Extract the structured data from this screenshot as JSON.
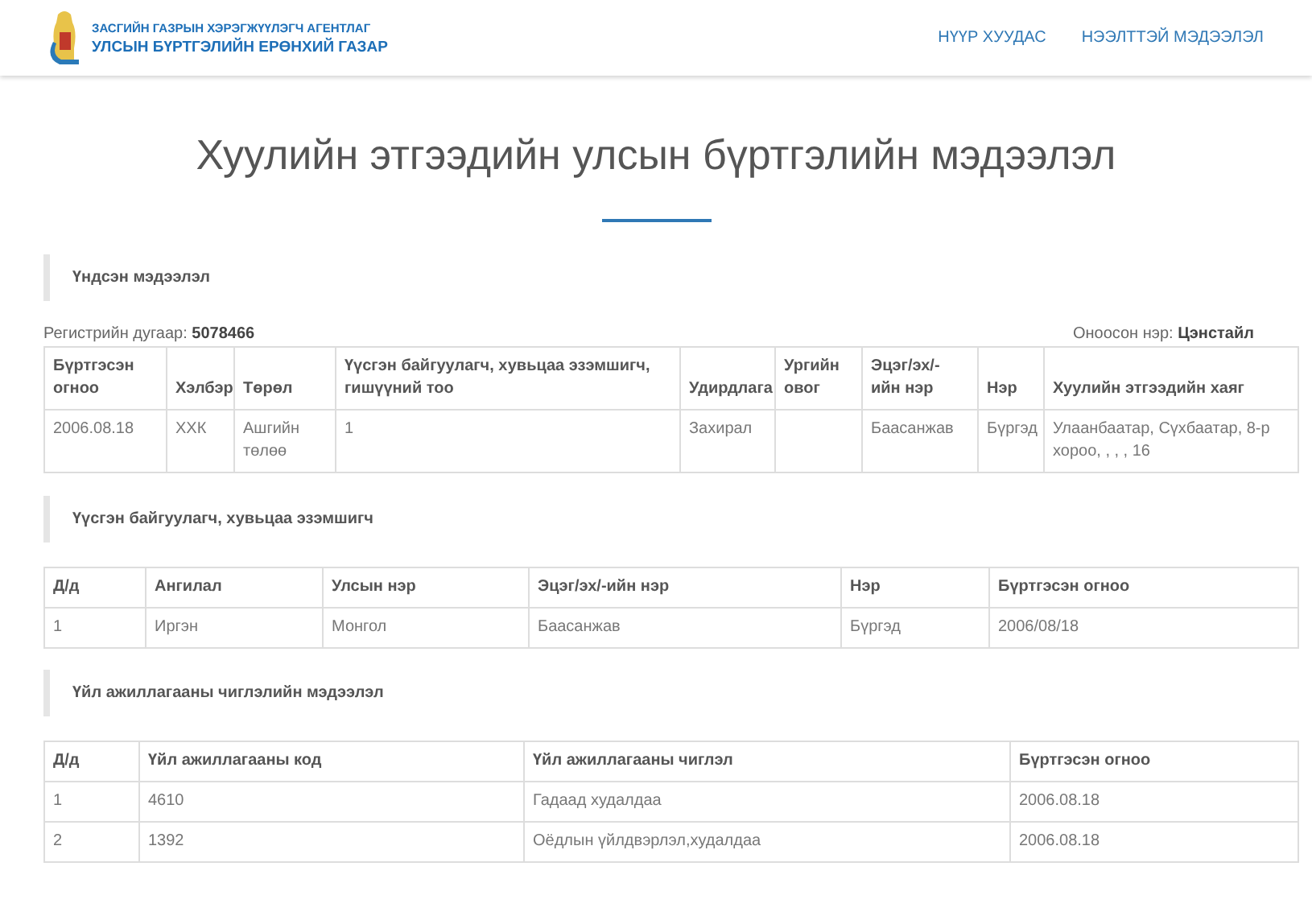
{
  "header": {
    "agency_line1": "ЗАСГИЙН ГАЗРЫН ХЭРЭГЖҮҮЛЭГЧ АГЕНТЛАГ",
    "agency_line2": "УЛСЫН БҮРТГЭЛИЙН ЕРӨНХИЙ ГАЗАР",
    "nav": [
      {
        "label": "НҮҮР ХУУДАС"
      },
      {
        "label": "НЭЭЛТТЭЙ МЭДЭЭЛЭЛ"
      }
    ]
  },
  "title": "Хуулийн этгээдийн улсын бүртгэлийн мэдээлэл",
  "sections": [
    {
      "heading": "Үндсэн мэдээлэл",
      "registration_label": "Регистрийн дугаар:",
      "registration_number": "5078466",
      "name_label": "Оноосон нэр:",
      "name_value": "Цэнстайл",
      "columns": [
        "Бүртгэсэн огноо",
        "Хэлбэр",
        "Төрөл",
        "Үүсгэн байгуулагч, хувьцаа эзэмшигч, гишүүний тоо",
        "Удирдлага",
        "Ургийн овог",
        "Эцэг/эх/-ийн нэр",
        "Нэр",
        "Хуулийн этгээдийн хаяг"
      ],
      "rows": [
        [
          "2006.08.18",
          "ХХК",
          "Ашгийн төлөө",
          "1",
          "Захирал",
          "",
          "Баасанжав",
          "Бүргэд",
          "Улаанбаатар, Сүхбаатар, 8-р хороо, , , , 16"
        ]
      ]
    },
    {
      "heading": "Үүсгэн байгуулагч, хувьцаа эзэмшигч",
      "columns": [
        "Д/д",
        "Ангилал",
        "Улсын нэр",
        "Эцэг/эх/-ийн нэр",
        "Нэр",
        "Бүртгэсэн огноо"
      ],
      "rows": [
        [
          "1",
          "Иргэн",
          "Монгол",
          "Баасанжав",
          "Бүргэд",
          "2006/08/18"
        ]
      ]
    },
    {
      "heading": "Үйл ажиллагааны чиглэлийн мэдээлэл",
      "columns": [
        "Д/д",
        "Үйл ажиллагааны код",
        "Үйл ажиллагааны чиглэл",
        "Бүртгэсэн огноо"
      ],
      "rows": [
        [
          "1",
          "4610",
          "Гадаад худалдаа",
          "2006.08.18"
        ],
        [
          "2",
          "1392",
          "Оёдлын үйлдвэрлэл,худалдаа",
          "2006.08.18"
        ]
      ]
    }
  ]
}
